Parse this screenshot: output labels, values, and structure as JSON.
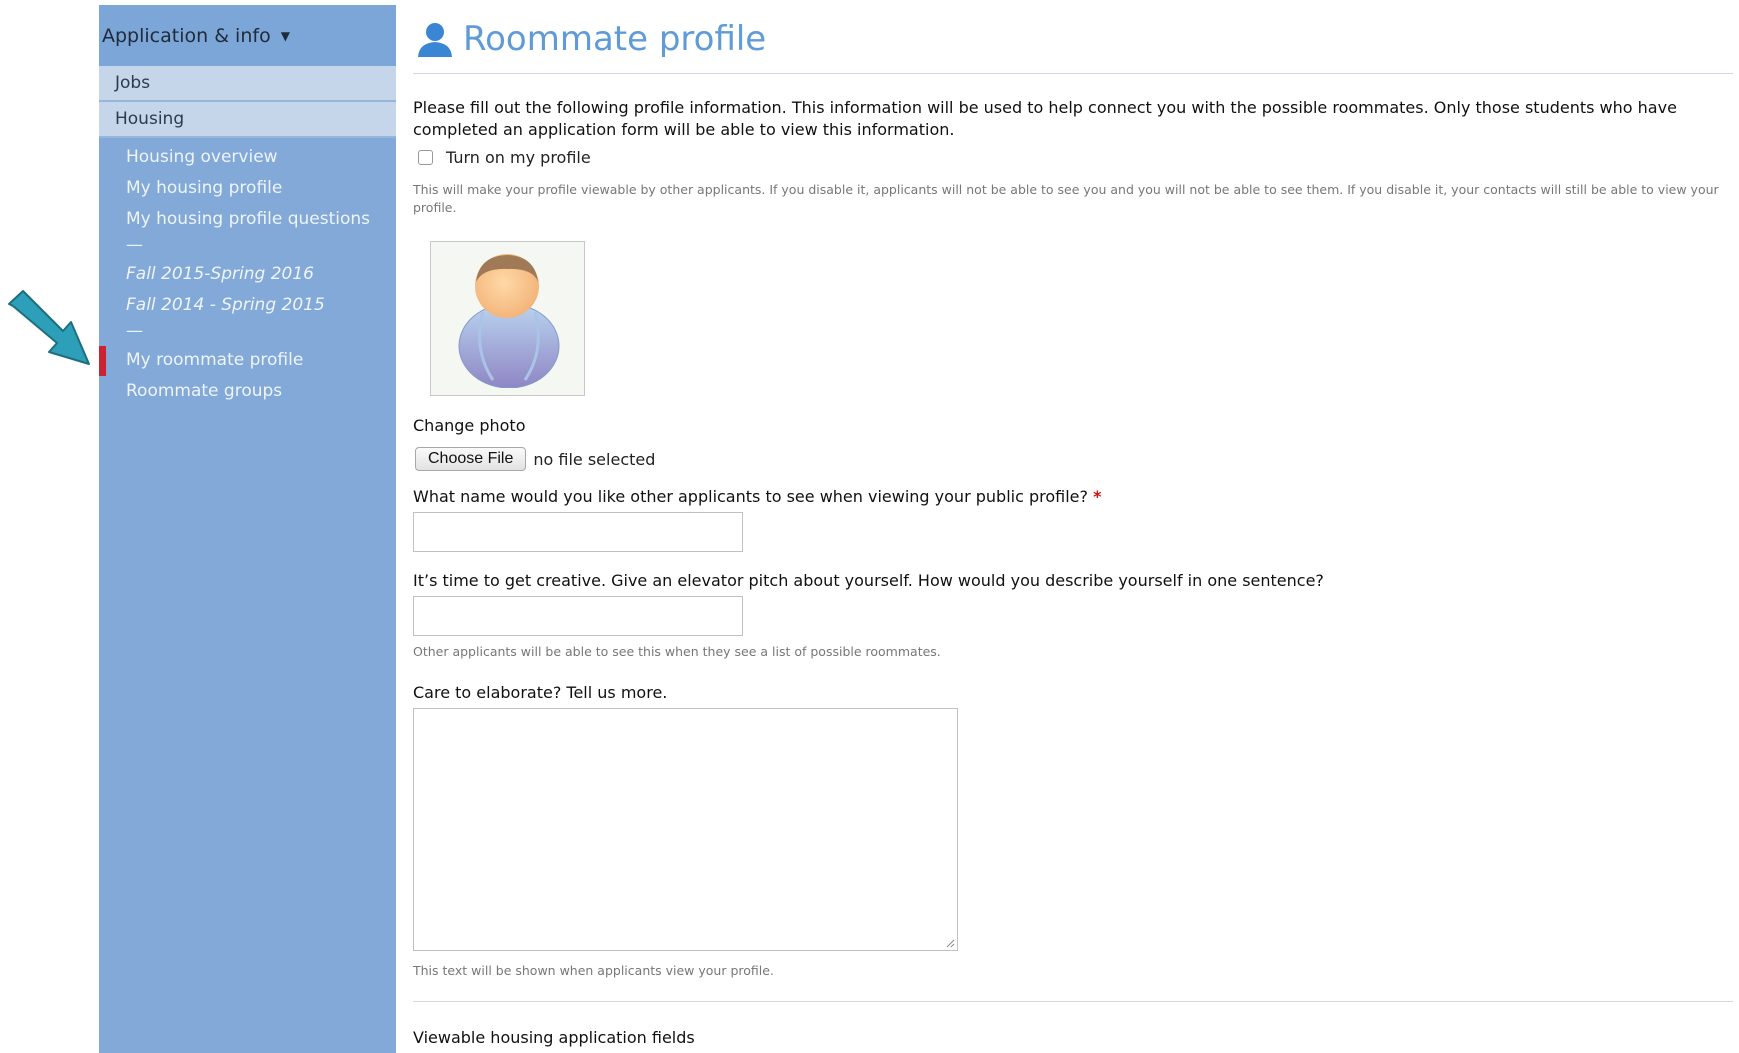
{
  "sidebar": {
    "header": "Application & info",
    "sections": [
      "Jobs",
      "Housing"
    ],
    "items": [
      {
        "label": "Housing overview",
        "style": "normal"
      },
      {
        "label": "My housing profile",
        "style": "normal"
      },
      {
        "label": "My housing profile questions",
        "style": "normal"
      },
      {
        "label": "—",
        "style": "sep"
      },
      {
        "label": "Fall 2015-Spring 2016",
        "style": "italic"
      },
      {
        "label": "Fall 2014 - Spring 2015",
        "style": "italic"
      },
      {
        "label": "—",
        "style": "sep"
      },
      {
        "label": "My roommate profile",
        "style": "active"
      },
      {
        "label": "Roommate groups",
        "style": "normal"
      }
    ]
  },
  "main": {
    "title": "Roommate profile",
    "intro": "Please fill out the following profile information. This information will be used to help connect you with the possible roommates. Only those students who have completed an application form will be able to view this information.",
    "toggle_label": "Turn on my profile",
    "toggle_help": "This will make your profile viewable by other applicants. If you disable it, applicants will not be able to see you and you will not be able to see them. If you disable it, your contacts will still be able to view your profile.",
    "change_photo_label": "Change photo",
    "choose_file_label": "Choose File",
    "file_status": "no file selected",
    "name_question": "What name would you like other applicants to see when viewing your public profile?",
    "required_mark": "*",
    "pitch_question": "It’s time to get creative. Give an elevator pitch about yourself. How would you describe yourself in one sentence?",
    "pitch_help": "Other applicants will be able to see this when they see a list of possible roommates.",
    "elaborate_question": "Care to elaborate? Tell us more.",
    "elaborate_help": "This text will be shown when applicants view your profile.",
    "viewable_heading": "Viewable housing application fields"
  },
  "colors": {
    "sidebar_bg": "#82a9d7",
    "section_bg": "#c5d6ea",
    "active_marker": "#cc2233",
    "title": "#5f9bd6",
    "arrow": "#2e9fb8"
  }
}
